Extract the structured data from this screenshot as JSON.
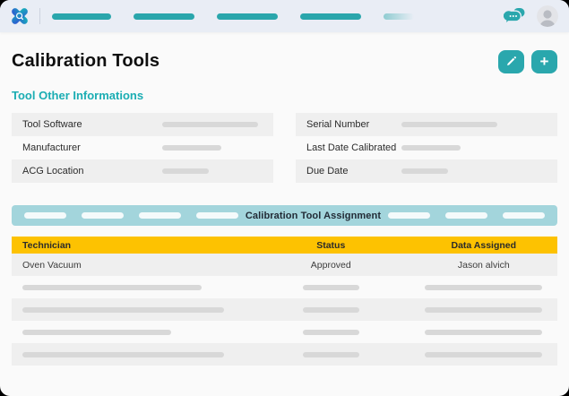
{
  "colors": {
    "teal_accent": "#2aa7ad",
    "section_title_teal": "#1badb3",
    "assignment_band_blue": "#a3d5dc",
    "table_header_yellow": "#fdc201",
    "row_stripe_gray": "#efefef",
    "nav_bg": "#e9edf5",
    "placeholder_gray": "#d8d8d8"
  },
  "icons": {
    "logo": "app-logo",
    "chat": "chat-bubbles",
    "avatar": "user-avatar",
    "edit": "pencil",
    "add": "plus"
  },
  "page": {
    "title": "Calibration Tools",
    "section_title": "Tool Other Informations",
    "add_glyph": "+"
  },
  "info_fields": {
    "left": [
      {
        "label": "Tool Software"
      },
      {
        "label": "Manufacturer"
      },
      {
        "label": "ACG Location"
      }
    ],
    "right": [
      {
        "label": "Serial Number"
      },
      {
        "label": "Last Date Calibrated"
      },
      {
        "label": "Due Date"
      }
    ]
  },
  "assignment": {
    "band_title": "Calibration Tool Assignment",
    "columns": {
      "technician": "Technician",
      "status": "Status",
      "data_assigned": "Data Assigned"
    },
    "rows": [
      {
        "technician": "Oven Vacuum",
        "status": "Approved",
        "data_assigned": "Jason alvich"
      }
    ],
    "placeholder_row_count": 4
  }
}
